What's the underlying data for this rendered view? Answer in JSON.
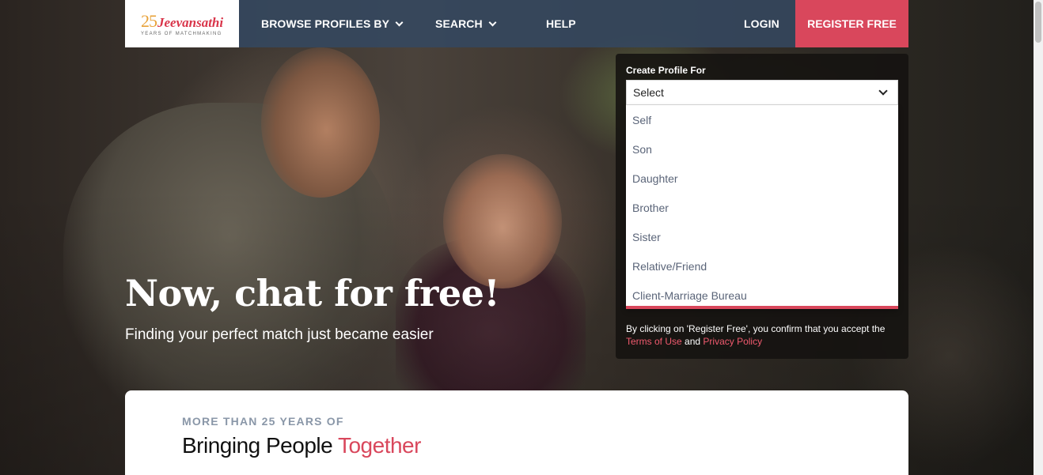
{
  "brand": {
    "number": "25",
    "name": "Jeevansathi",
    "tagline": "YEARS OF MATCHMAKING"
  },
  "nav": {
    "browse_label": "BROWSE PROFILES BY",
    "search_label": "SEARCH",
    "help_label": "HELP",
    "login_label": "LOGIN",
    "register_label": "REGISTER FREE"
  },
  "hero": {
    "title": "Now, chat for free!",
    "subtitle": "Finding your perfect match just became easier"
  },
  "register_form": {
    "label": "Create Profile For",
    "selected": "Select",
    "options": [
      "Self",
      "Son",
      "Daughter",
      "Brother",
      "Sister",
      "Relative/Friend",
      "Client-Marriage Bureau"
    ],
    "legal_text": "By clicking on 'Register Free', you confirm that you accept the",
    "terms_link": "Terms of Use",
    "and_text": "and",
    "privacy_link": "Privacy Policy"
  },
  "card": {
    "eyebrow": "MORE THAN 25 YEARS OF",
    "heading_plain": "Bringing People",
    "heading_accent": "Together"
  },
  "colors": {
    "accent": "#d9475c",
    "nav_bg": "#344860",
    "panel_bg": "#141210"
  }
}
